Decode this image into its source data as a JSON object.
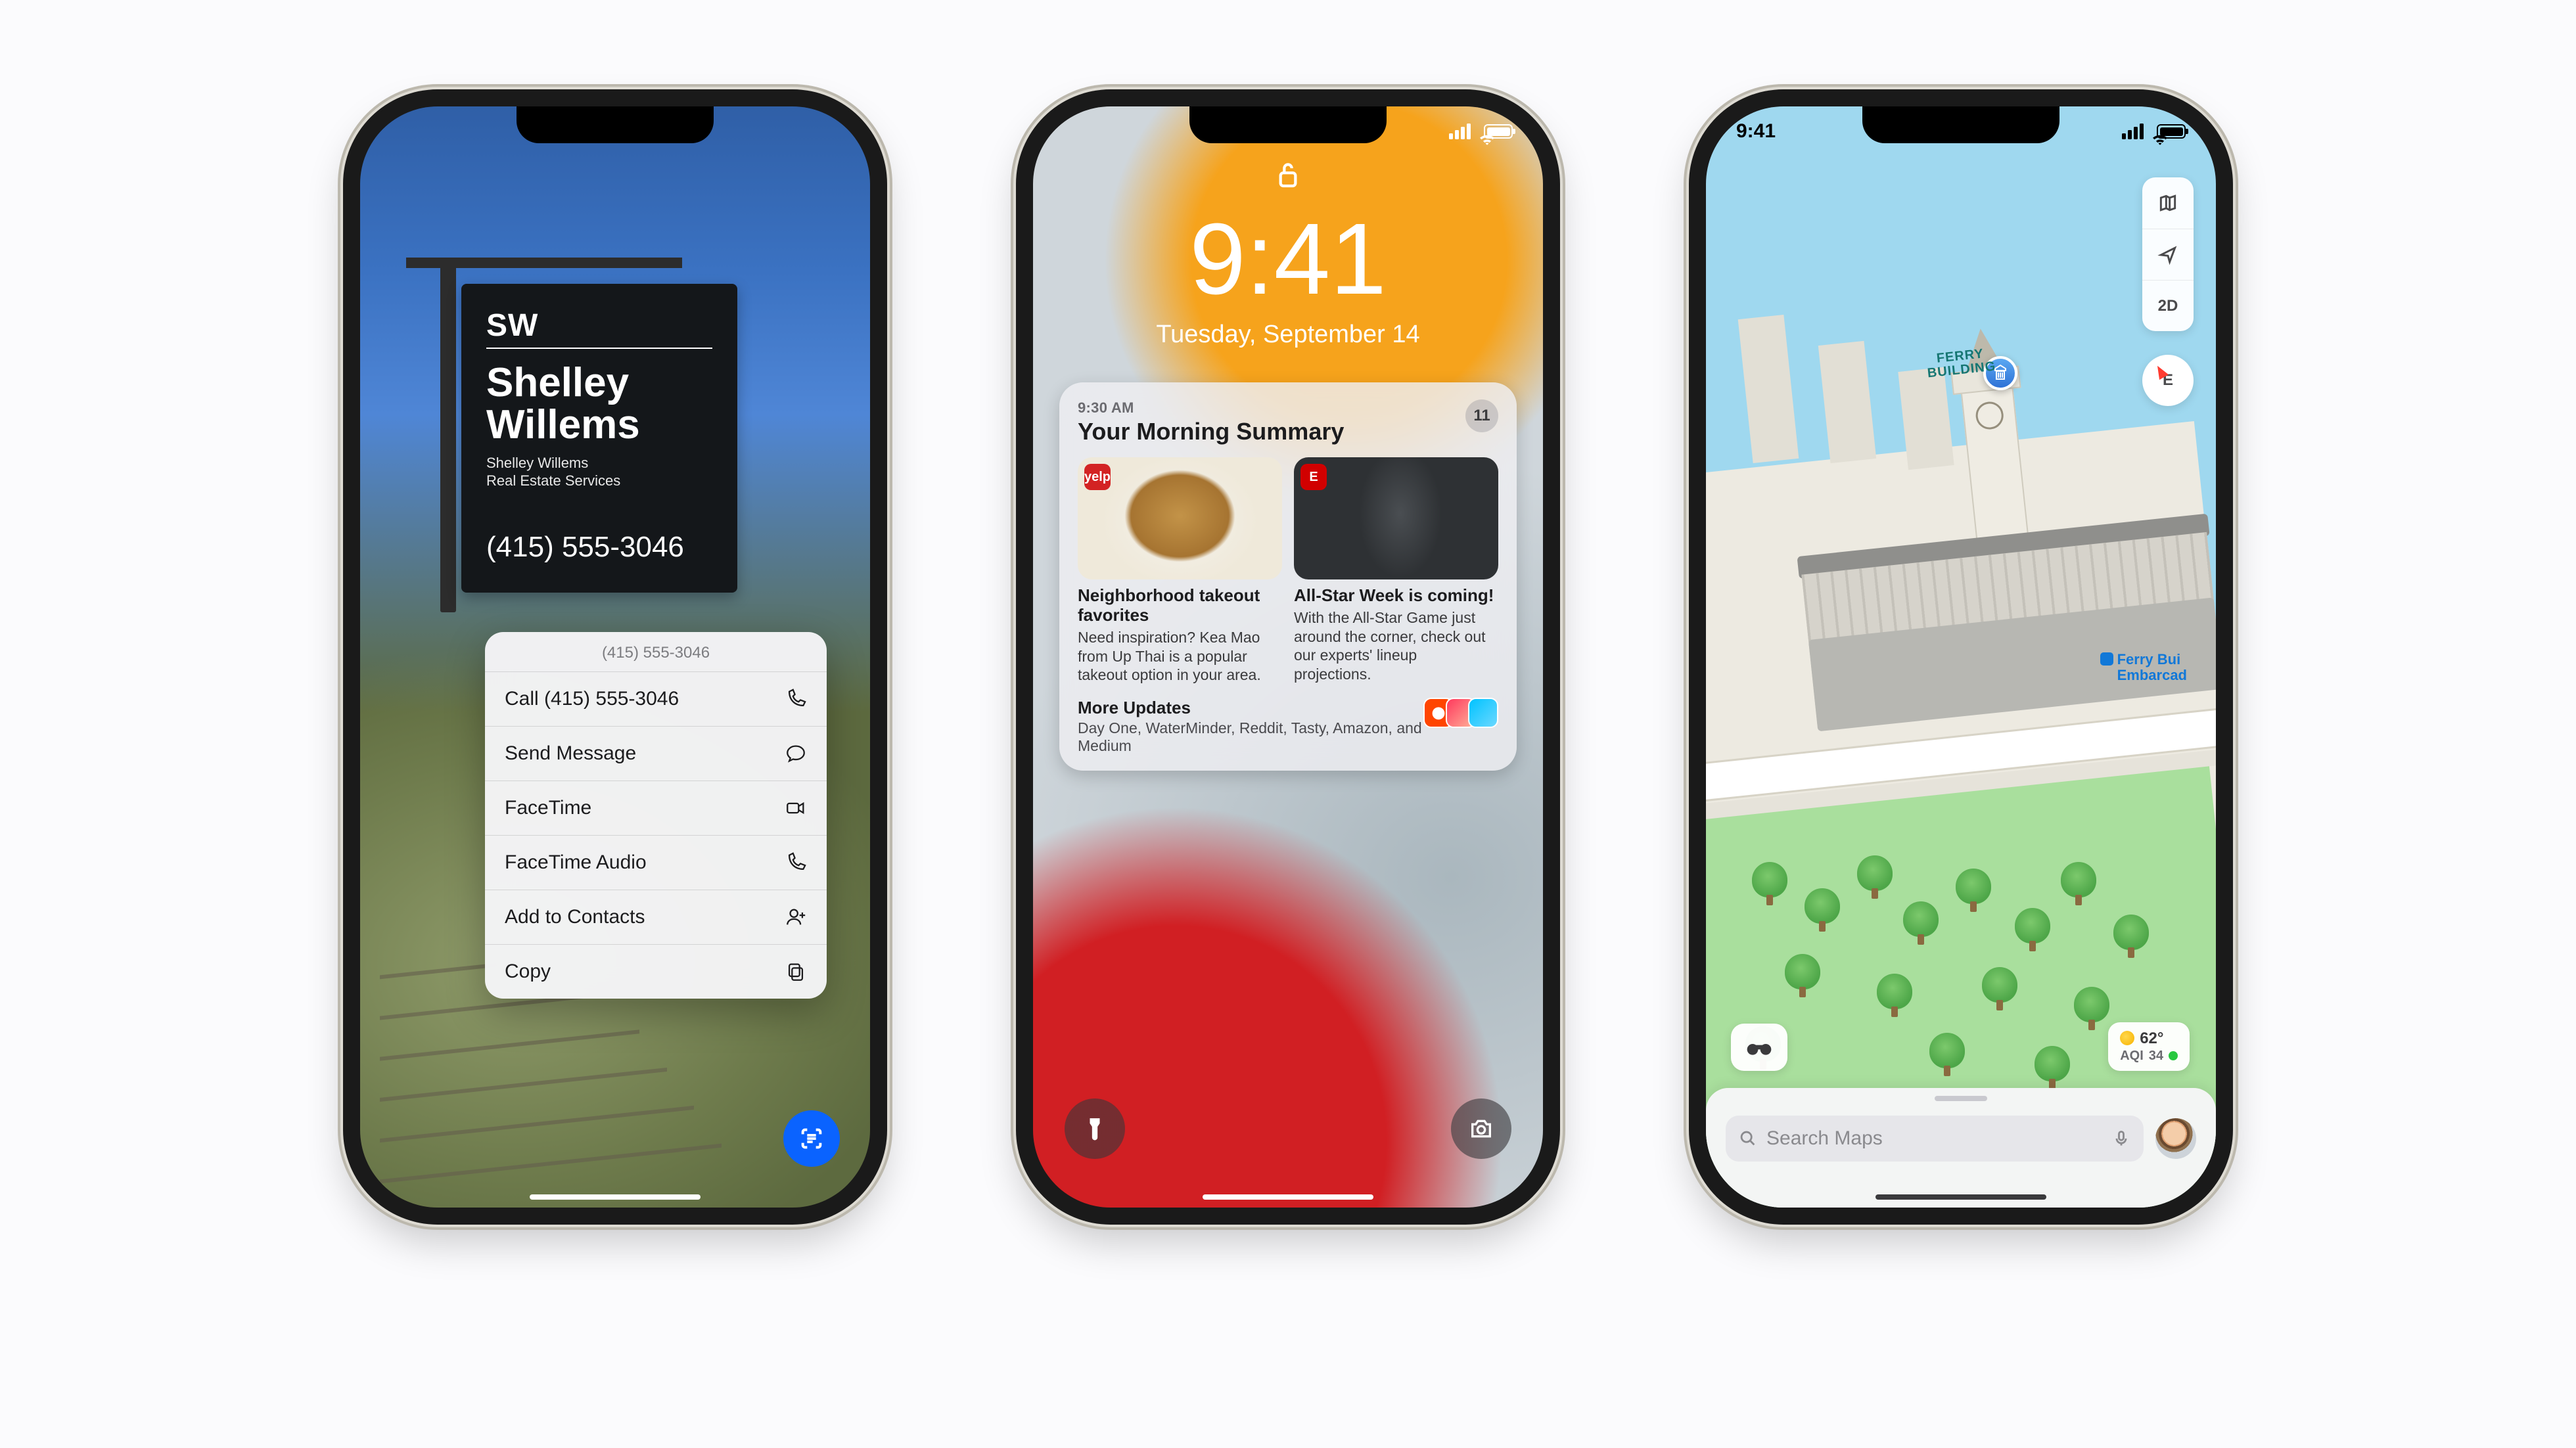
{
  "status": {
    "time": "9:41"
  },
  "livetext": {
    "sign": {
      "badge": "SW",
      "name_line1": "Shelley",
      "name_line2": "Willems",
      "sub_line1": "Shelley Willems",
      "sub_line2": "Real Estate Services",
      "phone": "(415) 555-3046"
    },
    "menu": {
      "header_number": "(415) 555-3046",
      "call": "Call (415) 555-3046",
      "message": "Send Message",
      "facetime": "FaceTime",
      "facetime_audio": "FaceTime Audio",
      "add_contacts": "Add to Contacts",
      "copy": "Copy"
    }
  },
  "lockscreen": {
    "time": "9:41",
    "date": "Tuesday, September 14",
    "summary": {
      "timestamp": "9:30 AM",
      "title": "Your Morning Summary",
      "count": "11",
      "items": [
        {
          "app": "yelp",
          "headline": "Neighborhood takeout favorites",
          "body": "Need inspiration? Kea Mao from Up Thai is a popular takeout option in your area."
        },
        {
          "app": "E",
          "headline": "All-Star Week is coming!",
          "body": "With the All-Star Game just around the corner, check out our experts' lineup projections."
        }
      ],
      "more_title": "More Updates",
      "more_body": "Day One, WaterMinder, Reddit, Tasty, Amazon, and Medium"
    }
  },
  "maps": {
    "poi_label_line1": "FERRY",
    "poi_label_line2": "BUILDING",
    "transit_label_line1": "Ferry Bui",
    "transit_label_line2": "Embarcad",
    "mode_2d": "2D",
    "compass": "E",
    "weather_temp": "62°",
    "weather_aqi_label": "AQI",
    "weather_aqi_value": "34",
    "search_placeholder": "Search Maps"
  }
}
